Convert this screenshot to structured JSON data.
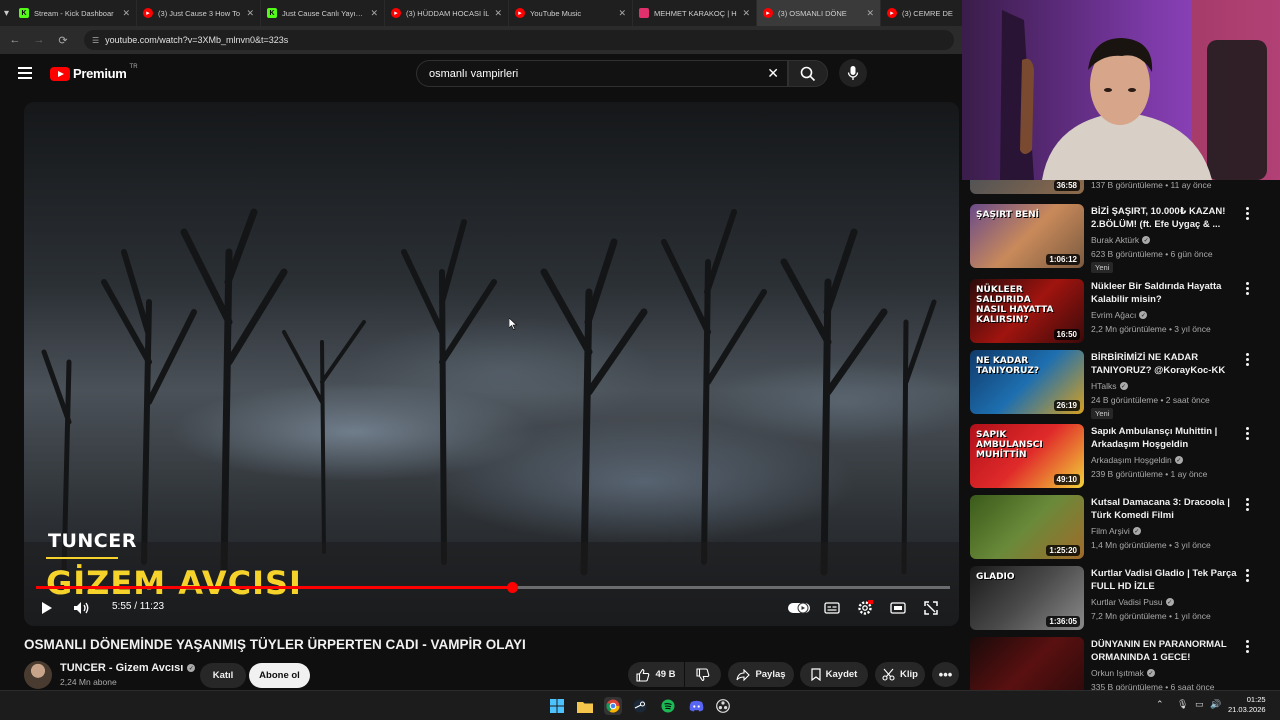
{
  "browser": {
    "tabs": [
      {
        "title": "Stream - Kick Dashboar",
        "favicon": "kick",
        "color": "#53fc18"
      },
      {
        "title": "(3) Just Cause 3 How To",
        "favicon": "youtube",
        "color": "#ff0000"
      },
      {
        "title": "Just Cause Canlı Yayınla",
        "favicon": "kick",
        "color": "#53fc18"
      },
      {
        "title": "(3) HÜDDAM HOCASI İL",
        "favicon": "youtube",
        "color": "#ff0000"
      },
      {
        "title": "YouTube Music",
        "favicon": "youtube-music",
        "color": "#ff0000"
      },
      {
        "title": "MEHMET KARAKOÇ | H",
        "favicon": "instagram",
        "color": "#e1306c"
      },
      {
        "title": "(3) OSMANLI DÖNE",
        "favicon": "youtube",
        "color": "#ff0000",
        "active": true
      },
      {
        "title": "(3) CEMRE DE",
        "favicon": "youtube",
        "color": "#ff0000"
      }
    ],
    "url": "youtube.com/watch?v=3XMb_mlnvn0&t=323s"
  },
  "header": {
    "logo_text": "Premium",
    "country_code": "TR",
    "search_value": "osmanlı vampirleri"
  },
  "player": {
    "overlay_name": "TUNCER",
    "overlay_brand": "GİZEM AVCISI",
    "current_time": "5:55",
    "duration": "11:23",
    "time_display": "5:55 / 11:23",
    "progress": 0.521
  },
  "video": {
    "title": "OSMANLI DÖNEMİNDE YAŞANMIŞ TÜYLER ÜRPERTEN CADI - VAMPİR OLAYI",
    "channel": "TUNCER - Gizem Avcısı",
    "subscribers": "2,24 Mn abone",
    "join_label": "Katıl",
    "subscribe_label": "Abone ol",
    "likes": "49 B",
    "share_label": "Paylaş",
    "save_label": "Kaydet",
    "clip_label": "Klip"
  },
  "recommendations": {
    "partial_top": {
      "duration": "36:58",
      "meta": "137 B görüntüleme • 11 ay önce"
    },
    "items": [
      {
        "title": "BİZİ ŞAŞIRT, 10.000₺ KAZAN! 2.BÖLÜM! (ft. Efe Uygaç & ...",
        "channel": "Burak Aktürk",
        "meta": "623 B görüntüleme • 6 gün önce",
        "duration": "1:06:12",
        "badge": "Yeni",
        "thumb_text": "ŞAŞIRT BENİ"
      },
      {
        "title": "Nükleer Bir Saldırıda Hayatta Kalabilir misin?",
        "channel": "Evrim Ağacı",
        "meta": "2,2 Mn görüntüleme • 3 yıl önce",
        "duration": "16:50",
        "badge": "",
        "thumb_text": "NÜKLEER SALDIRIDA NASIL HAYATTA KALIRSIN?"
      },
      {
        "title": "BİRBİRİMİZİ NE KADAR TANIYORUZ? @KorayKoc-KK",
        "channel": "HTalks",
        "meta": "24 B görüntüleme • 2 saat önce",
        "duration": "26:19",
        "badge": "Yeni",
        "thumb_text": "NE KADAR TANIYORUZ?"
      },
      {
        "title": "Sapık Ambulansçı Muhittin | Arkadaşım Hoşgeldin",
        "channel": "Arkadaşım Hoşgeldin",
        "meta": "239 B görüntüleme • 1 ay önce",
        "duration": "49:10",
        "badge": "",
        "thumb_text": "SAPIK AMBULANSCI MUHİTTİN"
      },
      {
        "title": "Kutsal Damacana 3: Dracoola | Türk Komedi Filmi",
        "channel": "Film Arşivi",
        "meta": "1,4 Mn görüntüleme • 3 yıl önce",
        "duration": "1:25:20",
        "badge": "",
        "thumb_text": ""
      },
      {
        "title": "Kurtlar Vadisi Gladio | Tek Parça FULL HD İZLE",
        "channel": "Kurtlar Vadisi Pusu",
        "meta": "7,2 Mn görüntüleme • 1 yıl önce",
        "duration": "1:36:05",
        "badge": "",
        "thumb_text": "GLADIO"
      },
      {
        "title": "DÜNYANIN EN PARANORMAL ORMANINDA 1 GECE!",
        "channel": "Orkun Işıtmak",
        "meta": "335 B görüntüleme • 6 saat önce",
        "duration": "",
        "badge": "",
        "thumb_text": ""
      }
    ]
  },
  "taskbar": {
    "time": "01:25",
    "date": "21.03.2026"
  },
  "colors": {
    "accent": "#ff0000",
    "background": "#0f0f0f",
    "brand_yellow": "#f6d32b"
  }
}
